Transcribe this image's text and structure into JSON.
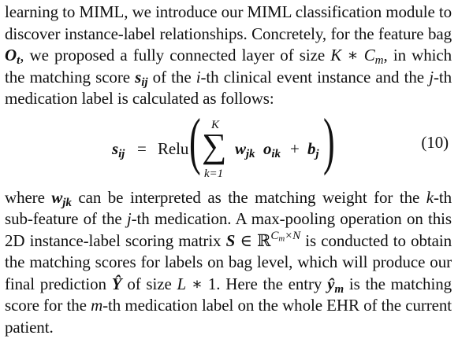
{
  "para1": {
    "t1": "learning to MIML, we introduce our MIML classification module to discover instance-label relationships. Concretely, for the feature bag ",
    "bag_sym": "O",
    "bag_sub": "t",
    "t2": ", we proposed a fully connected layer of size ",
    "size_K": "K",
    "size_star": " ∗ ",
    "size_C": "C",
    "size_Csub": "m",
    "t3": ", in which the matching score ",
    "score_sym": "s",
    "score_sub": "ij",
    "t4": " of the ",
    "i_sym": "i",
    "t5": "-th clinical event instance and the ",
    "j_sym": "j",
    "t6": "-th medication label is calculated as follows:"
  },
  "equation": {
    "lhs": "s",
    "lhs_sub": "ij",
    "eq": "=",
    "relu": "Relu",
    "sum_upper": "K",
    "sum_lower": "k=1",
    "w": "w",
    "w_sub": "jk",
    "o": "o",
    "o_sub": "ik",
    "plus": "+",
    "b": "b",
    "b_sub": "j",
    "number": "(10)"
  },
  "para2": {
    "t1": "where ",
    "w_sym": "w",
    "w_sub": "jk",
    "t2": " can be interpreted as the matching weight for the ",
    "k_sym": "k",
    "t3": "-th sub-feature of the ",
    "j_sym": "j",
    "t4": "-th medication. A max-pooling operation on this 2D instance-label scoring matrix ",
    "S_sym": "S",
    "in_sym": " ∈ ",
    "R_sym": "ℝ",
    "R_sup": "C",
    "R_sup_sub": "m",
    "R_sup_rest": "×N",
    "t5": " is conducted to obtain the matching scores for labels on bag level, which will produce our final prediction ",
    "Y_sym": "Ŷ",
    "t6": " of size ",
    "L_sym": "L",
    "t7": " ∗ 1. Here the entry ",
    "y_sym": "ŷ",
    "y_sub": "m",
    "t8": " is the matching score for the ",
    "m_sym": "m",
    "t9": "-th medication label on the whole EHR of the current patient."
  }
}
